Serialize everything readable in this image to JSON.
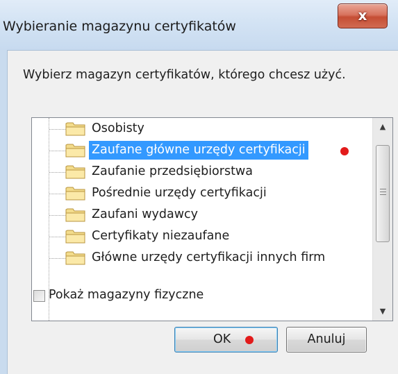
{
  "window": {
    "title": "Wybieranie magazynu certyfikatów",
    "close_glyph": "x"
  },
  "prompt": "Wybierz magazyn certyfikatów, którego chcesz użyć.",
  "tree": {
    "items": [
      {
        "label": "Osobisty",
        "selected": false,
        "icon": "folder-icon"
      },
      {
        "label": "Zaufane główne urzędy certyfikacji",
        "selected": true,
        "icon": "folder-icon"
      },
      {
        "label": "Zaufanie przedsiębiorstwa",
        "selected": false,
        "icon": "folder-icon"
      },
      {
        "label": "Pośrednie urzędy certyfikacji",
        "selected": false,
        "icon": "folder-icon"
      },
      {
        "label": "Zaufani wydawcy",
        "selected": false,
        "icon": "folder-icon"
      },
      {
        "label": "Certyfikaty niezaufane",
        "selected": false,
        "icon": "folder-icon"
      },
      {
        "label": "Główne urzędy certyfikacji innych firm",
        "selected": false,
        "icon": "folder-icon"
      }
    ],
    "selection_color": "#3399ff"
  },
  "show_physical": {
    "label": "Pokaż magazyny fizyczne",
    "checked": false
  },
  "buttons": {
    "ok_label": "OK",
    "cancel_label": "Anuluj"
  },
  "colors": {
    "annotation_dot": "#e21b1b",
    "close_button": "#c54e34"
  }
}
